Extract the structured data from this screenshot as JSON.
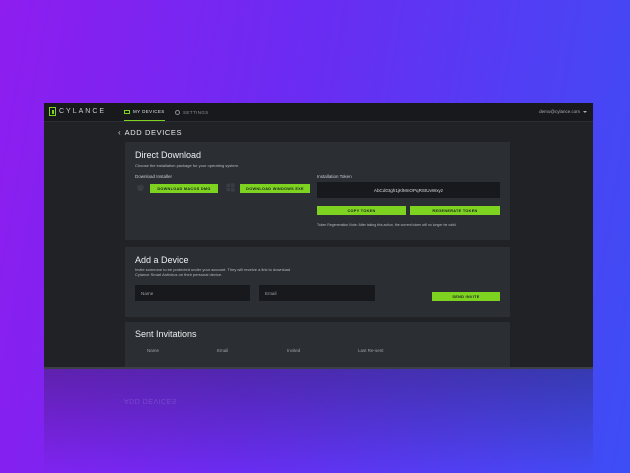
{
  "brand": {
    "name": "CYLANCE",
    "accent": "#7ed321"
  },
  "nav": {
    "items": [
      {
        "label": "MY DEVICES",
        "icon": "monitor-icon",
        "active": true
      },
      {
        "label": "SETTINGS",
        "icon": "gear-icon",
        "active": false
      }
    ],
    "user_email": "demo@cylance.com"
  },
  "page": {
    "title": "ADD DEVICES",
    "back_icon": "chevron-left-icon"
  },
  "direct_download": {
    "title": "Direct Download",
    "subtitle": "Choose the installation package for your operating system.",
    "installer_label": "Download Installer",
    "mac_button": "DOWNLOAD MACOS DMG",
    "windows_button": "DOWNLOAD WINDOWS EXE",
    "token_label": "Installation Token",
    "token_value": "AbCdGtgh1jKlMnOPqRStUvWxyz",
    "copy_button": "COPY TOKEN",
    "regenerate_button": "REGENERATE TOKEN",
    "token_note": "Token Regeneration Note: After taking this action, the current token will no longer be valid."
  },
  "add_device": {
    "title": "Add a Device",
    "description_line1": "Invite someone to be protected under your account. They will receive a link to download",
    "description_line2": "Cylance Smart Antivirus on their personal device.",
    "name_placeholder": "Name",
    "email_placeholder": "Email",
    "send_button": "SEND INVITE"
  },
  "sent_invitations": {
    "title": "Sent Invitations",
    "columns": [
      "Name",
      "Email",
      "Invited",
      "Last Re-sent"
    ]
  }
}
